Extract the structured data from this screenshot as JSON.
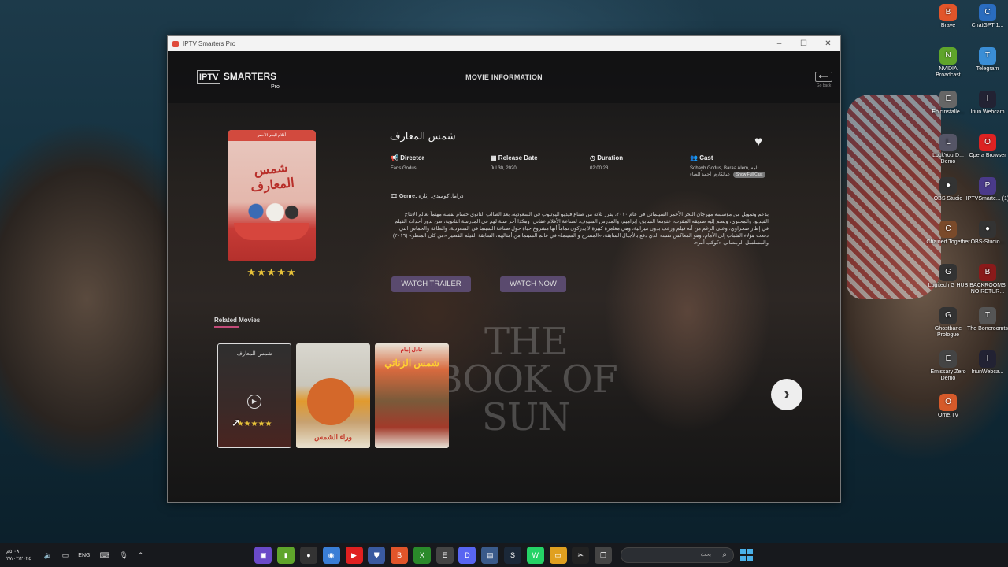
{
  "window": {
    "title": "IPTV Smarters Pro",
    "controls": {
      "minimize": "–",
      "maximize": "☐",
      "close": "✕"
    }
  },
  "header": {
    "logo_iptv": "IPTV",
    "logo_smarters": "SMARTERS",
    "logo_pro": "Pro",
    "page_title": "MOVIE INFORMATION",
    "go_back_label": "Go back"
  },
  "movie": {
    "title": "شمس المعارف",
    "rating_stars": "★★★★★",
    "rating": 5,
    "poster_top_text": "أفلام البحر الأحمر",
    "poster_title": "شمس المعارف",
    "director_label": "Director",
    "director": "Faris Godus",
    "release_label": "Release Date",
    "release_date": "Jul 30, 2020",
    "duration_label": "Duration",
    "duration": "02:00:23",
    "cast_label": "Cast",
    "cast_line1": "Sohayb Godus, Baraa Alem, ثامة",
    "cast_line2": "عبالكارم, أحمد الصاء",
    "show_full_cast": "Show Full Cast",
    "genre_label": "Genre:",
    "genre": "دراما, كوميدي, إثارة",
    "plot": "بدعم وتمويل من مؤسسة مهرجان البحر الأحمر السينمائي في عام ٢٠١٠، يقرر ثلاثة من صناع فيديو اليوتيوب في السعودية، بعد الطالب الثانوي حسام نفسه مهتماً بعالم الإنتاج الفيديو، والمحتوى، ويضم إليه صديقه المقرب، عثومعا السابق، إبراهيم، والمدرس السيوف، لصناعة الأفلام عفاني، وهكذا أخر سنة لهم في المدرسة الثانوية، ظن تدور أحداث الفيلم في إطار صحراوي، وعلى الرغم من أنه فيلم ورعب بدون ميزانية، وهي مغامرة كبيرة لا يدركون تماماً أنها مشروع حياة حول صناعة السينما في السعودية، والطاقة والحماس التي دفعت هؤلاء الشباب إلى الأمام، وهو المعاكس نفسه الذي دفع بالأجيال السابقة، «المسرح و السينما» في عالم السينما من أمثالهم، السابقة الفيلم القصير «من كان المتطر» (٢٠١٦) والمسلسل الرمضاني «كوكب أمر»."
  },
  "actions": {
    "watch_trailer": "WATCH TRAILER",
    "watch_now": "WATCH NOW"
  },
  "related": {
    "heading": "Related Movies",
    "items": [
      {
        "title": "شمس المعارف",
        "stars": "★★★★★"
      },
      {
        "title": "وراء الشمس"
      },
      {
        "head": "عادل إمام",
        "title": "شمس الزناتي"
      }
    ],
    "next_icon": "›",
    "background_text": "THE BOOK OF SUN"
  },
  "desktop_icons": [
    {
      "label": "Brave",
      "color": "#e2552a",
      "glyph": "B"
    },
    {
      "label": "ChatGPT 1...",
      "color": "#2a6cbf",
      "glyph": "C"
    },
    {
      "label": "NVIDIA Broadcast",
      "color": "#5fa52b",
      "glyph": "N"
    },
    {
      "label": "Telegram",
      "color": "#3a8ed6",
      "glyph": "T"
    },
    {
      "label": "Epicinstalle...",
      "color": "#666",
      "glyph": "E"
    },
    {
      "label": "Iriun Webcam",
      "color": "#223",
      "glyph": "I"
    },
    {
      "label": "LockYourD... Demo",
      "color": "#556",
      "glyph": "L"
    },
    {
      "label": "Opera Browser",
      "color": "#d22",
      "glyph": "O"
    },
    {
      "label": "OBS Studio",
      "color": "#333",
      "glyph": "●"
    },
    {
      "label": "IPTVSmarte... (1)",
      "color": "#4a3a8a",
      "glyph": "P"
    },
    {
      "label": "Chained Together",
      "color": "#7a4a2a",
      "glyph": "C"
    },
    {
      "label": "OBS-Studio...",
      "color": "#333",
      "glyph": "●"
    },
    {
      "label": "Logitech G HUB",
      "color": "#333",
      "glyph": "G"
    },
    {
      "label": "BACKROOMS NO RETUR...",
      "color": "#8a1a1a",
      "glyph": "B"
    },
    {
      "label": "Ghostbane Prologue",
      "color": "#333",
      "glyph": "G"
    },
    {
      "label": "The Boneroomts",
      "color": "#555",
      "glyph": "T"
    },
    {
      "label": "Emissary Zero Demo",
      "color": "#444",
      "glyph": "E"
    },
    {
      "label": "IriunWebca...",
      "color": "#223",
      "glyph": "I"
    },
    {
      "label": "Ome.TV",
      "color": "#d65a2a",
      "glyph": "O"
    }
  ],
  "taskbar": {
    "clock_time": "٥:٠٨م",
    "clock_date": "٢٧/٠٢/٢٠٢٤",
    "language": "ENG",
    "search_placeholder": "بحث",
    "apps": [
      {
        "name": "iptv",
        "color": "#6a4ac8",
        "glyph": "▣"
      },
      {
        "name": "nvidia",
        "color": "#5fa52b",
        "glyph": "▮"
      },
      {
        "name": "obs",
        "color": "#333",
        "glyph": "●"
      },
      {
        "name": "chrome",
        "color": "#3a7ed6",
        "glyph": "◉"
      },
      {
        "name": "youtube",
        "color": "#e02020",
        "glyph": "▶"
      },
      {
        "name": "shield",
        "color": "#3a5aa0",
        "glyph": "⛊"
      },
      {
        "name": "brave",
        "color": "#e2552a",
        "glyph": "B"
      },
      {
        "name": "xbox",
        "color": "#2a8a2a",
        "glyph": "X"
      },
      {
        "name": "epic",
        "color": "#444",
        "glyph": "E"
      },
      {
        "name": "discord",
        "color": "#5865f2",
        "glyph": "D"
      },
      {
        "name": "store",
        "color": "#3a5a8a",
        "glyph": "▤"
      },
      {
        "name": "steam",
        "color": "#1b2838",
        "glyph": "S"
      },
      {
        "name": "whatsapp",
        "color": "#25d366",
        "glyph": "W"
      },
      {
        "name": "explorer",
        "color": "#e0a020",
        "glyph": "▭"
      },
      {
        "name": "capcut",
        "color": "#222",
        "glyph": "✂"
      },
      {
        "name": "multitask",
        "color": "#444",
        "glyph": "❐"
      }
    ]
  }
}
